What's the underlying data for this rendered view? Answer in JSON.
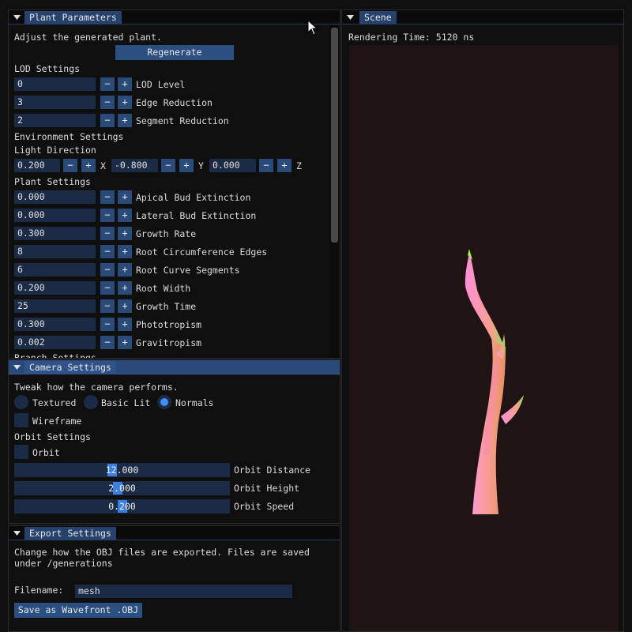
{
  "plant_params": {
    "title": "Plant Parameters",
    "intro": "Adjust the generated plant.",
    "regenerate_label": "Regenerate",
    "lod_heading": "LOD Settings",
    "lod": [
      {
        "value": "0",
        "label": "LOD Level"
      },
      {
        "value": "3",
        "label": "Edge Reduction"
      },
      {
        "value": "2",
        "label": "Segment Reduction"
      }
    ],
    "env_heading": "Environment Settings",
    "light_heading": "Light Direction",
    "light": [
      {
        "value": "0.200",
        "axis": "X"
      },
      {
        "value": "-0.800",
        "axis": "Y"
      },
      {
        "value": "0.000",
        "axis": "Z"
      }
    ],
    "plant_heading": "Plant Settings",
    "plant": [
      {
        "value": "0.000",
        "label": "Apical Bud Extinction"
      },
      {
        "value": "0.000",
        "label": "Lateral Bud Extinction"
      },
      {
        "value": "0.300",
        "label": "Growth Rate"
      },
      {
        "value": "8",
        "label": "Root Circumference Edges"
      },
      {
        "value": "6",
        "label": "Root Curve Segments"
      },
      {
        "value": "0.200",
        "label": "Root Width"
      },
      {
        "value": "25",
        "label": "Growth Time"
      },
      {
        "value": "0.300",
        "label": "Phototropism"
      },
      {
        "value": "0.002",
        "label": "Gravitropism"
      }
    ],
    "cut_heading": "Branch Settings",
    "minus": "−",
    "plus": "+"
  },
  "camera": {
    "title": "Camera Settings",
    "intro": "Tweak how the camera performs.",
    "render_modes": [
      {
        "label": "Textured",
        "selected": false
      },
      {
        "label": "Basic Lit",
        "selected": false
      },
      {
        "label": "Normals",
        "selected": true
      }
    ],
    "wireframe_label": "Wireframe",
    "orbit_heading": "Orbit Settings",
    "orbit_label": "Orbit",
    "sliders": [
      {
        "value": "12.000",
        "label": "Orbit Distance",
        "fraction": 0.45
      },
      {
        "value": "2.000",
        "label": "Orbit Height",
        "fraction": 0.48
      },
      {
        "value": "0.200",
        "label": "Orbit Speed",
        "fraction": 0.5
      }
    ]
  },
  "export": {
    "title": "Export Settings",
    "description_line1": "Change how the OBJ files are exported. Files are saved",
    "description_line2": "under /generations",
    "filename_label": "Filename:",
    "filename_value": "mesh",
    "save_label": "Save as Wavefront .OBJ"
  },
  "scene": {
    "title": "Scene",
    "render_time": "Rendering Time: 5120 ns",
    "background": "#201314"
  },
  "colors": {
    "accent": "#3d8ef0",
    "frame_bg": "#1c2b45",
    "button": "#2a4a7a"
  }
}
